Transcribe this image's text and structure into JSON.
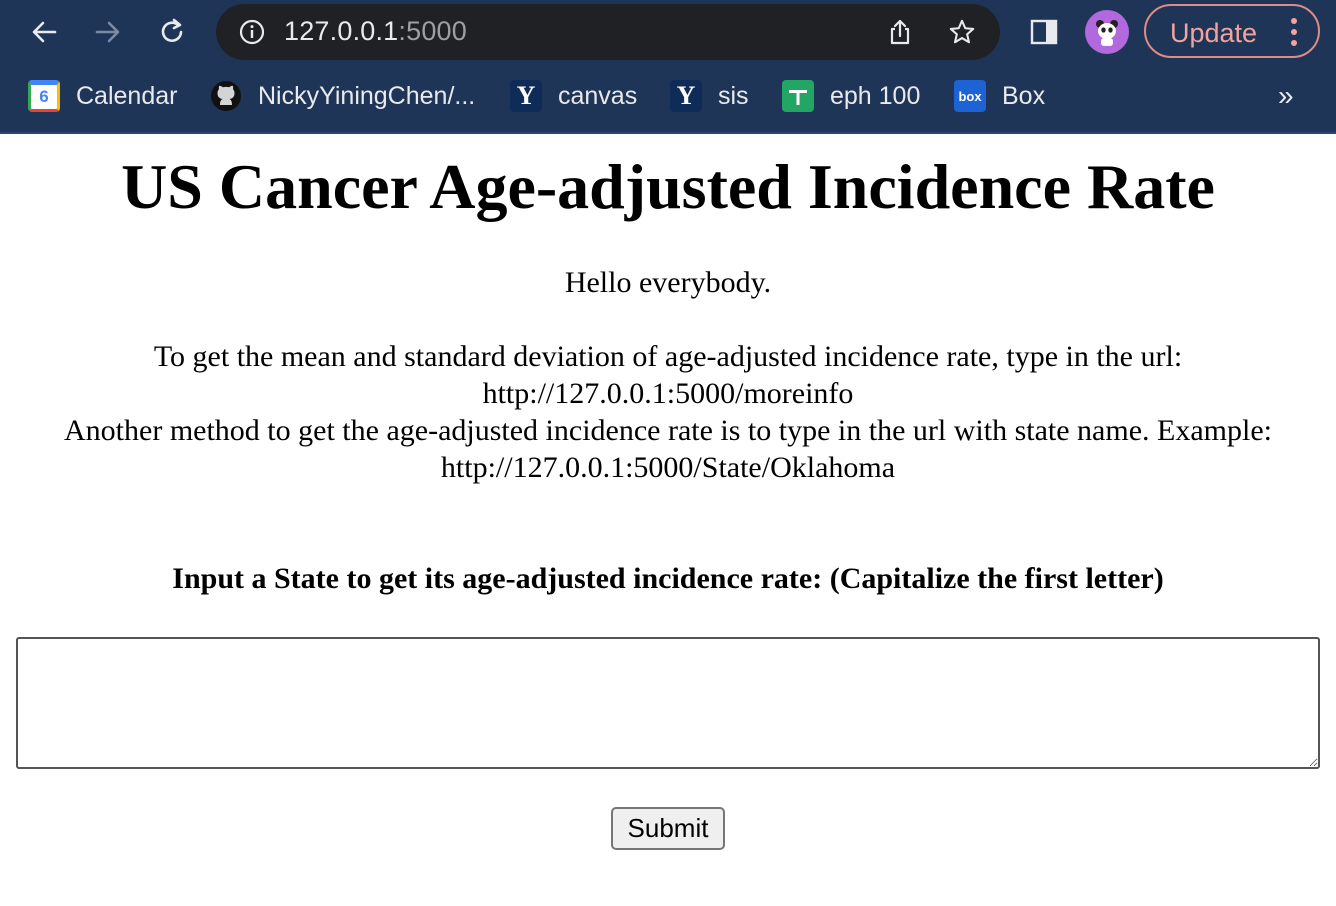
{
  "browser": {
    "url_host": "127.0.0.1",
    "url_port": ":5000",
    "update_label": "Update",
    "icons": [
      "back-arrow-icon",
      "forward-arrow-icon",
      "reload-icon",
      "info-icon",
      "share-icon",
      "star-icon",
      "side-panel-icon",
      "profile-avatar",
      "more-vert-icon"
    ],
    "bookmarks": [
      {
        "label": "Calendar",
        "icon": "google-calendar-icon",
        "icon_text": "6"
      },
      {
        "label": "NickyYiningChen/...",
        "icon": "github-icon"
      },
      {
        "label": "canvas",
        "icon": "yale-icon",
        "icon_text": "Y"
      },
      {
        "label": "sis",
        "icon": "yale-icon",
        "icon_text": "Y"
      },
      {
        "label": "eph 100",
        "icon": "google-sheets-icon"
      },
      {
        "label": "Box",
        "icon": "box-icon",
        "icon_text": "box"
      }
    ],
    "overflow_label": "»",
    "colors": {
      "chrome": "#1f3558",
      "omnibox": "#202124",
      "update_accent": "#f3a29c",
      "avatar": "#b169dd"
    }
  },
  "page": {
    "title": "US Cancer Age-adjusted Incidence Rate",
    "greeting": "Hello everybody.",
    "instructions": [
      "To get the mean and standard deviation of age-adjusted incidence rate, type in the url:",
      "http://127.0.0.1:5000/moreinfo",
      "Another method to get the age-adjusted incidence rate is to type in the url with state name. Example:",
      "http://127.0.0.1:5000/State/Oklahoma"
    ],
    "form": {
      "label": "Input a State to get its age-adjusted incidence rate: (Capitalize the first letter)",
      "input_value": "",
      "submit_label": "Submit"
    }
  }
}
